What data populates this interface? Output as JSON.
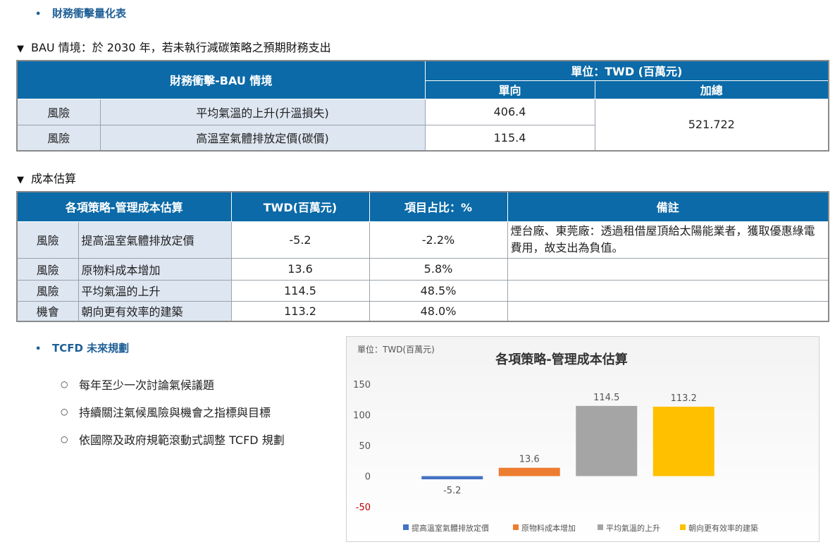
{
  "section1": {
    "bullet": "•",
    "title": "財務衝擊量化表"
  },
  "bau": {
    "heading": "BAU 情境：於 2030 年，若未執行減碳策略之預期財務支出",
    "table": {
      "header_left": "財務衝擊-BAU 情境",
      "header_unit": "單位：TWD (百萬元)",
      "col_single": "單向",
      "col_total": "加總",
      "rows": [
        {
          "type": "風險",
          "item": "平均氣溫的上升(升溫損失)",
          "value": "406.4"
        },
        {
          "type": "風險",
          "item": "高溫室氣體排放定價(碳價)",
          "value": "115.4"
        }
      ],
      "total": "521.722"
    }
  },
  "cost": {
    "heading": "成本估算",
    "table": {
      "headers": [
        "各項策略-管理成本估算",
        "TWD(百萬元)",
        "項目占比：%",
        "備註"
      ],
      "rows": [
        {
          "type": "風險",
          "item": "提高溫室氣體排放定價",
          "twd": "-5.2",
          "pct": "-2.2%",
          "note": "煙台廠、東莞廠：透過租借屋頂給太陽能業者，獲取優惠綠電費用，故支出為負值。"
        },
        {
          "type": "風險",
          "item": "原物料成本增加",
          "twd": "13.6",
          "pct": "5.8%",
          "note": ""
        },
        {
          "type": "風險",
          "item": "平均氣溫的上升",
          "twd": "114.5",
          "pct": "48.5%",
          "note": ""
        },
        {
          "type": "機會",
          "item": "朝向更有效率的建築",
          "twd": "113.2",
          "pct": "48.0%",
          "note": ""
        }
      ]
    }
  },
  "tcfd": {
    "bullet": "•",
    "title": "TCFD 未來規劃",
    "items": [
      "每年至少一次討論氣候議題",
      "持續關注氣候風險與機會之指標與目標",
      "依國際及政府規範滾動式調整 TCFD 規劃"
    ]
  },
  "chart_data": {
    "type": "bar",
    "title": "各項策略-管理成本估算",
    "unit_label": "單位：TWD(百萬元)",
    "categories": [
      "提高溫室氣體排放定價",
      "原物料成本增加",
      "平均氣溫的上升",
      "朝向更有效率的建築"
    ],
    "values": [
      -5.2,
      13.6,
      114.5,
      113.2
    ],
    "colors": [
      "#4472c4",
      "#ed7d31",
      "#a5a5a5",
      "#ffc000"
    ],
    "yticks": [
      150,
      100,
      50,
      0,
      -50
    ],
    "ylim": [
      -50,
      150
    ],
    "negative_tick_color": "#c00000",
    "grid": false,
    "legend": "bottom"
  }
}
